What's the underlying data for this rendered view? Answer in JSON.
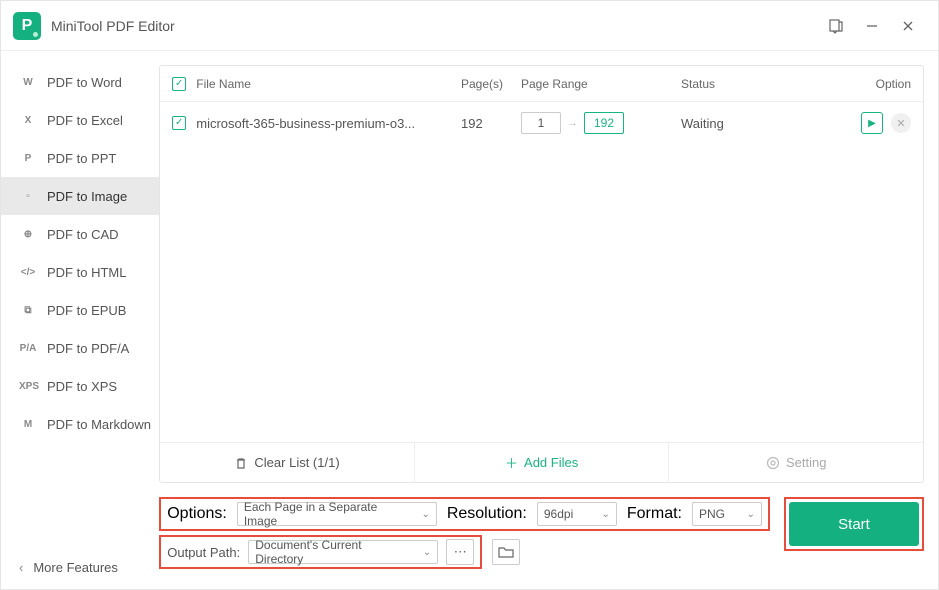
{
  "app": {
    "title": "MiniTool PDF Editor"
  },
  "sidebar": {
    "items": [
      {
        "ico": "W",
        "label": "PDF to Word"
      },
      {
        "ico": "X",
        "label": "PDF to Excel"
      },
      {
        "ico": "P",
        "label": "PDF to PPT"
      },
      {
        "ico": "▫",
        "label": "PDF to Image"
      },
      {
        "ico": "⊕",
        "label": "PDF to CAD"
      },
      {
        "ico": "</>",
        "label": "PDF to HTML"
      },
      {
        "ico": "⧉",
        "label": "PDF to EPUB"
      },
      {
        "ico": "P/A",
        "label": "PDF to PDF/A"
      },
      {
        "ico": "XPS",
        "label": "PDF to XPS"
      },
      {
        "ico": "M",
        "label": "PDF to Markdown"
      }
    ],
    "active_index": 3,
    "more": "More Features"
  },
  "table": {
    "headers": {
      "name": "File Name",
      "pages": "Page(s)",
      "range": "Page Range",
      "status": "Status",
      "option": "Option"
    },
    "rows": [
      {
        "name": "microsoft-365-business-premium-o3...",
        "pages": "192",
        "from": "1",
        "to": "192",
        "status": "Waiting"
      }
    ],
    "footer": {
      "clear": "Clear List (1/1)",
      "add": "Add Files",
      "setting": "Setting"
    }
  },
  "options": {
    "options_label": "Options:",
    "options_value": "Each Page in a Separate Image",
    "resolution_label": "Resolution:",
    "resolution_value": "96dpi",
    "format_label": "Format:",
    "format_value": "PNG",
    "output_label": "Output Path:",
    "output_value": "Document's Current Directory"
  },
  "start": {
    "label": "Start"
  }
}
